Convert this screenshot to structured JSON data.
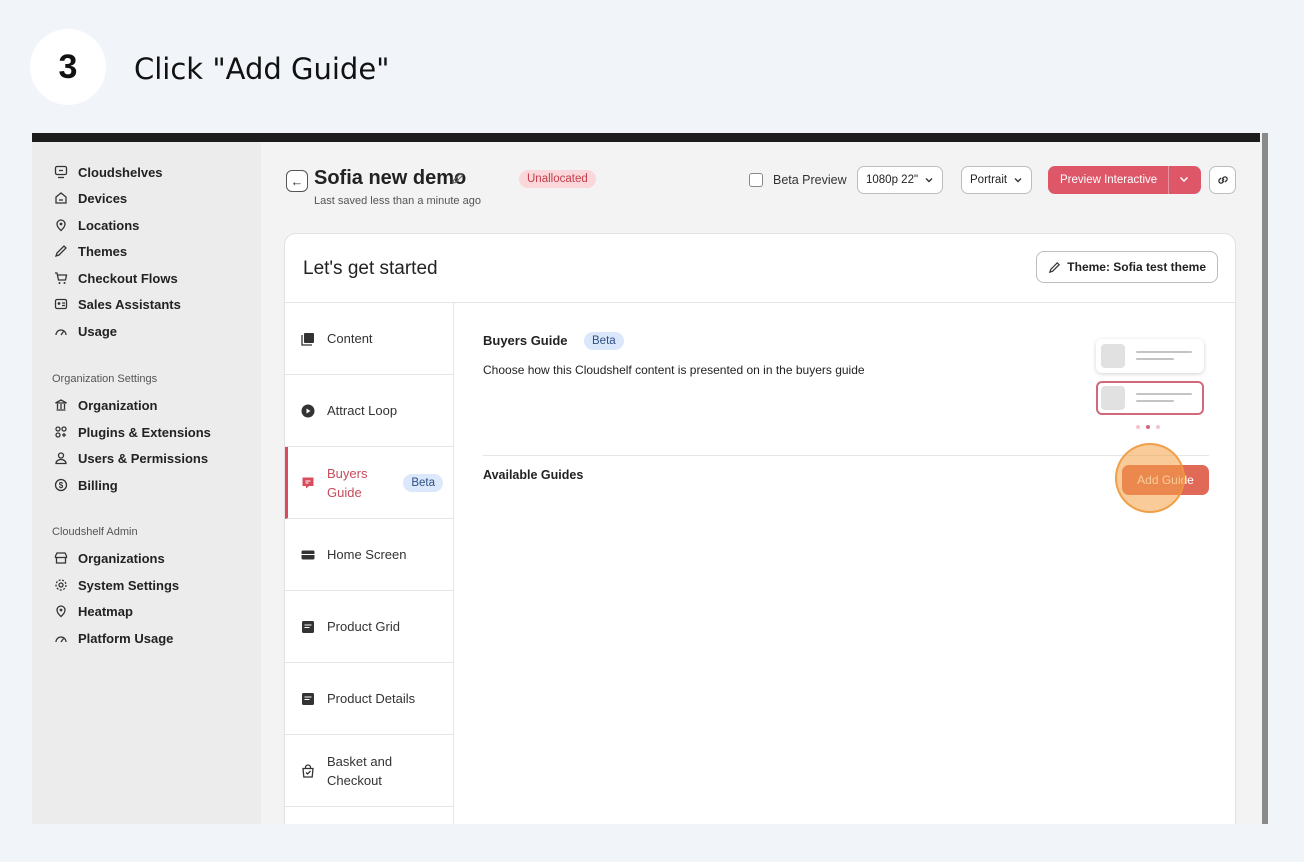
{
  "step": {
    "number": "3",
    "instruction": "Click \"Add Guide\""
  },
  "sidebar": {
    "items": [
      {
        "label": "Cloudshelves",
        "icon": "cloudshelves-icon"
      },
      {
        "label": "Devices",
        "icon": "devices-icon"
      },
      {
        "label": "Locations",
        "icon": "location-pin-icon"
      },
      {
        "label": "Themes",
        "icon": "brush-icon"
      },
      {
        "label": "Checkout Flows",
        "icon": "cart-icon"
      },
      {
        "label": "Sales Assistants",
        "icon": "id-card-icon"
      },
      {
        "label": "Usage",
        "icon": "gauge-icon"
      }
    ],
    "org_section_label": "Organization Settings",
    "org_items": [
      {
        "label": "Organization",
        "icon": "bank-icon"
      },
      {
        "label": "Plugins & Extensions",
        "icon": "plugin-icon"
      },
      {
        "label": "Users & Permissions",
        "icon": "user-icon"
      },
      {
        "label": "Billing",
        "icon": "dollar-icon"
      }
    ],
    "admin_section_label": "Cloudshelf Admin",
    "admin_items": [
      {
        "label": "Organizations",
        "icon": "store-icon"
      },
      {
        "label": "System Settings",
        "icon": "gear-icon"
      },
      {
        "label": "Heatmap",
        "icon": "location-pin-icon"
      },
      {
        "label": "Platform Usage",
        "icon": "gauge-icon"
      }
    ]
  },
  "header": {
    "title": "Sofia new demo",
    "status_badge": "Unallocated",
    "subtitle": "Last saved less than a minute ago",
    "beta_preview_label": "Beta Preview",
    "resolution_select": "1080p 22\"",
    "orientation_select": "Portrait",
    "preview_button": "Preview Interactive"
  },
  "card": {
    "title": "Let's get started",
    "theme_button": "Theme: Sofia test theme"
  },
  "tabs": [
    {
      "label": "Content",
      "icon": "gallery-icon"
    },
    {
      "label": "Attract Loop",
      "icon": "play-circle-icon"
    },
    {
      "label_line1": "Buyers",
      "label_line2": "Guide",
      "badge": "Beta",
      "icon": "chat-icon"
    },
    {
      "label": "Home Screen",
      "icon": "screen-icon"
    },
    {
      "label": "Product Grid",
      "icon": "document-icon"
    },
    {
      "label": "Product Details",
      "icon": "document-icon"
    },
    {
      "label_line1": "Basket and",
      "label_line2": "Checkout",
      "icon": "bag-icon"
    }
  ],
  "content": {
    "section_title": "Buyers Guide",
    "section_badge": "Beta",
    "description": "Choose how this Cloudshelf content is presented on in the buyers guide",
    "available_label": "Available Guides",
    "add_button": "Add Guide"
  },
  "colors": {
    "accent": "#dd5768",
    "add_button": "#e06a57",
    "beta_badge": "#dbe8fb",
    "unallocated_badge": "#f9d7da"
  }
}
